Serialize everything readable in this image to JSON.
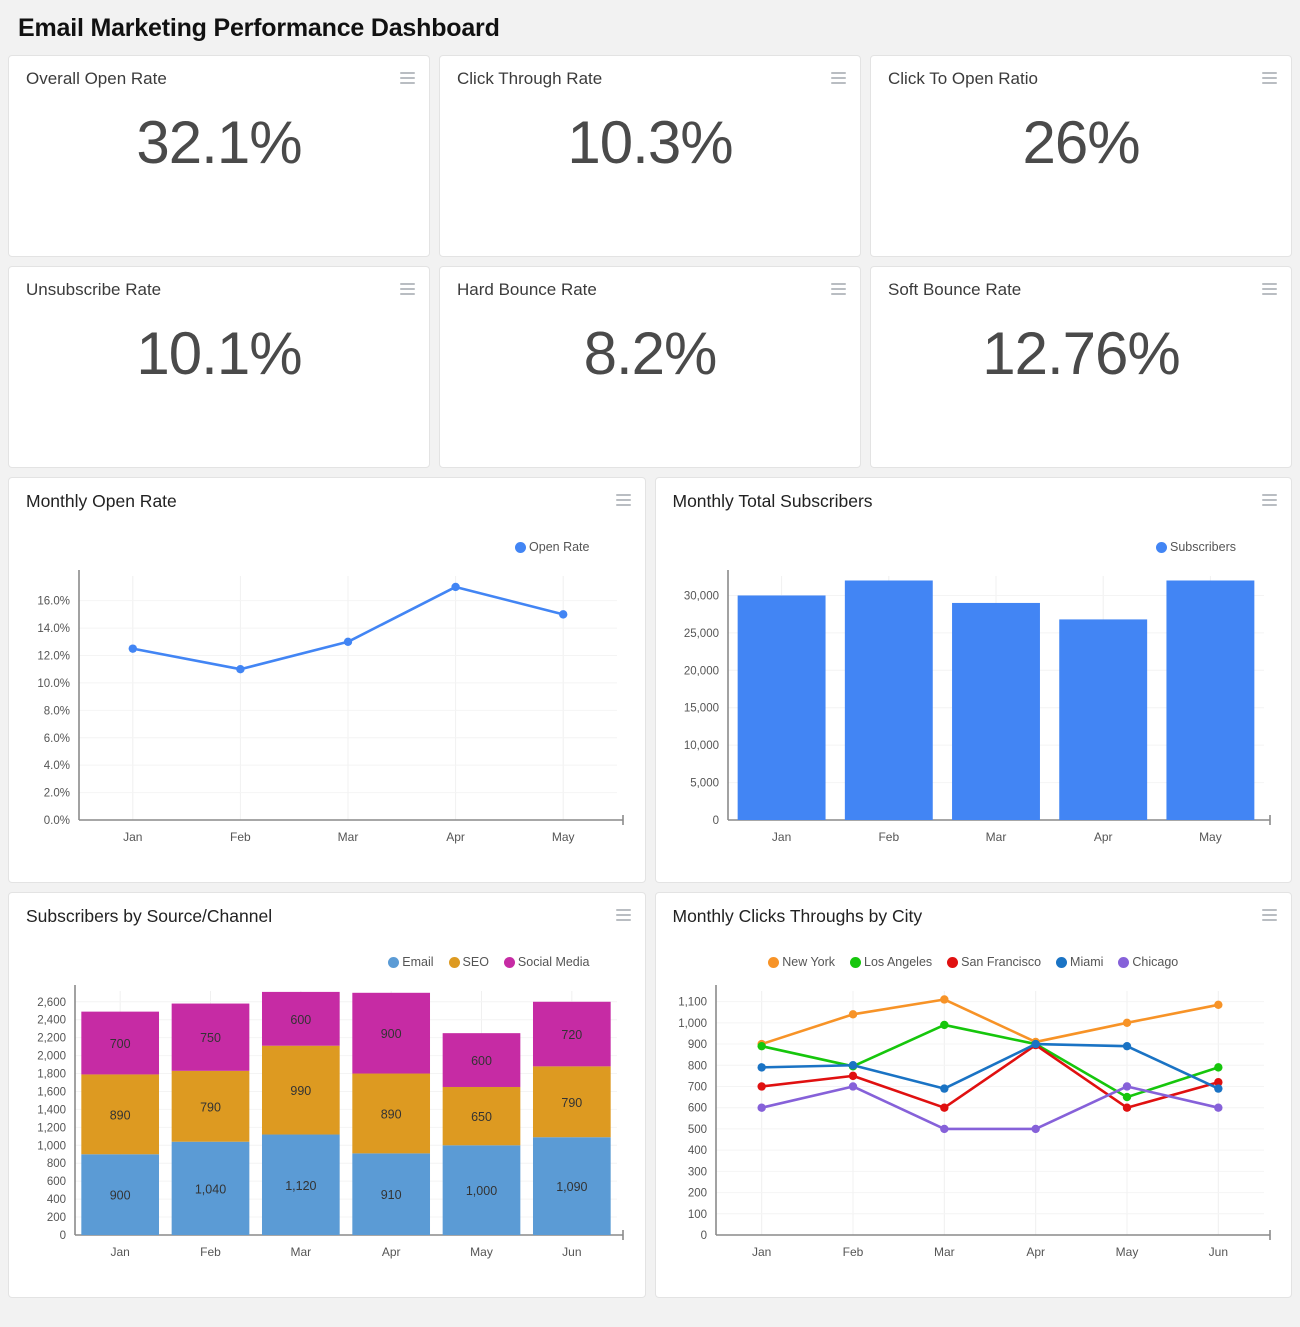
{
  "page_title": "Email Marketing Performance Dashboard",
  "menu_icon": "hamburger-menu-icon",
  "kpis": [
    {
      "title": "Overall Open Rate",
      "value": "32.1%"
    },
    {
      "title": "Click Through Rate",
      "value": "10.3%"
    },
    {
      "title": "Click To Open Ratio",
      "value": "26%"
    },
    {
      "title": "Unsubscribe Rate",
      "value": "10.1%"
    },
    {
      "title": "Hard Bounce Rate",
      "value": "8.2%"
    },
    {
      "title": "Soft Bounce Rate",
      "value": "12.76%"
    }
  ],
  "charts": [
    {
      "title": "Monthly Open Rate"
    },
    {
      "title": "Monthly Total Subscribers"
    },
    {
      "title": "Subscribers by Source/Channel"
    },
    {
      "title": "Monthly Clicks Throughs by City"
    }
  ],
  "chart_data": [
    {
      "type": "line",
      "title": "Monthly Open Rate",
      "categories": [
        "Jan",
        "Feb",
        "Mar",
        "Apr",
        "May"
      ],
      "series": [
        {
          "name": "Open Rate",
          "color": "#4285F4",
          "values": [
            12.5,
            11.0,
            13.0,
            17.0,
            15.0
          ]
        }
      ],
      "ytick_labels": [
        "0.0%",
        "2.0%",
        "4.0%",
        "6.0%",
        "8.0%",
        "10.0%",
        "12.0%",
        "14.0%",
        "16.0%"
      ],
      "yticks": [
        0,
        2,
        4,
        6,
        8,
        10,
        12,
        14,
        16
      ],
      "ylim": [
        0,
        17.8
      ],
      "xlabel": "",
      "ylabel": "",
      "legend": "top-right",
      "grid": true
    },
    {
      "type": "bar",
      "title": "Monthly Total Subscribers",
      "categories": [
        "Jan",
        "Feb",
        "Mar",
        "Apr",
        "May"
      ],
      "series": [
        {
          "name": "Subscribers",
          "color": "#4285F4",
          "values": [
            30000,
            32000,
            29000,
            26800,
            32000
          ]
        }
      ],
      "ytick_labels": [
        "0",
        "5,000",
        "10,000",
        "15,000",
        "20,000",
        "25,000",
        "30,000"
      ],
      "yticks": [
        0,
        5000,
        10000,
        15000,
        20000,
        25000,
        30000
      ],
      "ylim": [
        0,
        32600
      ],
      "xlabel": "",
      "ylabel": "",
      "legend": "top-right",
      "grid": true
    },
    {
      "type": "bar",
      "stacked": true,
      "title": "Subscribers by Source/Channel",
      "categories": [
        "Jan",
        "Feb",
        "Mar",
        "Apr",
        "May",
        "Jun"
      ],
      "series": [
        {
          "name": "Email",
          "color": "#5B9BD5",
          "values": [
            900,
            1040,
            1120,
            910,
            1000,
            1090
          ],
          "labels": [
            "900",
            "1,040",
            "1,120",
            "910",
            "1,000",
            "1,090"
          ]
        },
        {
          "name": "SEO",
          "color": "#DD9A21",
          "values": [
            890,
            790,
            990,
            890,
            650,
            790
          ],
          "labels": [
            "890",
            "790",
            "990",
            "890",
            "650",
            "790"
          ]
        },
        {
          "name": "Social Media",
          "color": "#C62BA4",
          "values": [
            700,
            750,
            600,
            900,
            600,
            720
          ],
          "labels": [
            "700",
            "750",
            "600",
            "900",
            "600",
            "720"
          ]
        }
      ],
      "ytick_labels": [
        "0",
        "200",
        "400",
        "600",
        "800",
        "1,000",
        "1,200",
        "1,400",
        "1,600",
        "1,800",
        "2,000",
        "2,200",
        "2,400",
        "2,600"
      ],
      "yticks": [
        0,
        200,
        400,
        600,
        800,
        1000,
        1200,
        1400,
        1600,
        1800,
        2000,
        2200,
        2400,
        2600
      ],
      "ylim": [
        0,
        2720
      ],
      "xlabel": "",
      "ylabel": "",
      "legend": "top-right",
      "grid": true
    },
    {
      "type": "line",
      "title": "Monthly Clicks Throughs by City",
      "categories": [
        "Jan",
        "Feb",
        "Mar",
        "Apr",
        "May",
        "Jun"
      ],
      "series": [
        {
          "name": "New York",
          "color": "#F79327",
          "values": [
            900,
            1040,
            1110,
            910,
            1000,
            1085
          ]
        },
        {
          "name": "Los Angeles",
          "color": "#16C60C",
          "values": [
            890,
            795,
            990,
            900,
            650,
            790
          ]
        },
        {
          "name": "San Francisco",
          "color": "#E01010",
          "values": [
            700,
            750,
            600,
            895,
            600,
            720
          ]
        },
        {
          "name": "Miami",
          "color": "#1A73C4",
          "values": [
            790,
            800,
            690,
            900,
            890,
            690
          ]
        },
        {
          "name": "Chicago",
          "color": "#8661D9",
          "values": [
            600,
            700,
            500,
            500,
            700,
            600
          ]
        }
      ],
      "ytick_labels": [
        "0",
        "100",
        "200",
        "300",
        "400",
        "500",
        "600",
        "700",
        "800",
        "900",
        "1,000",
        "1,100"
      ],
      "yticks": [
        0,
        100,
        200,
        300,
        400,
        500,
        600,
        700,
        800,
        900,
        1000,
        1100
      ],
      "ylim": [
        0,
        1150
      ],
      "xlabel": "",
      "ylabel": "",
      "legend": "top-center",
      "grid": true
    }
  ]
}
